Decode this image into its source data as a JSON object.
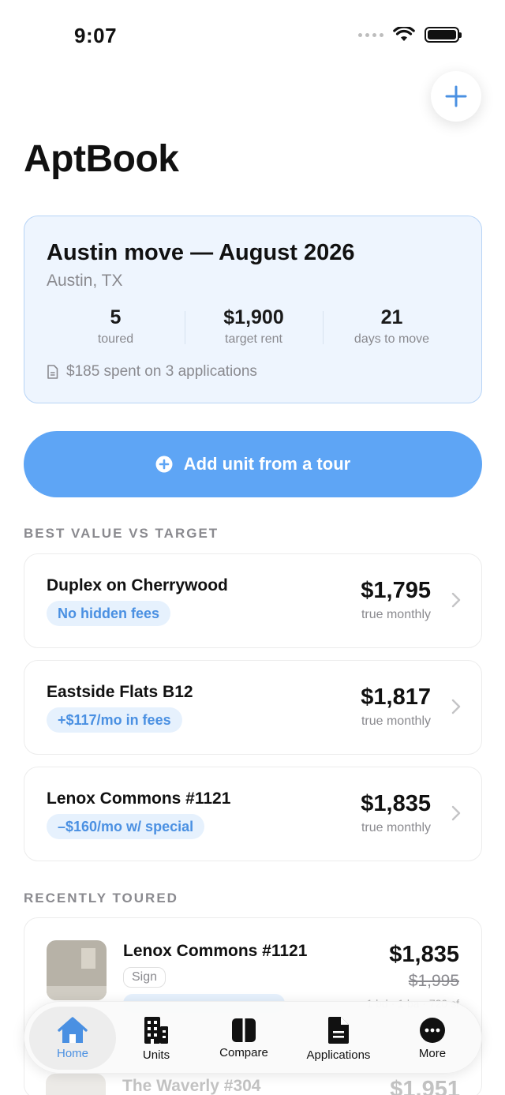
{
  "status": {
    "time": "9:07"
  },
  "header": {
    "title": "AptBook",
    "add_icon": "plus-icon"
  },
  "move": {
    "title": "Austin move — August 2026",
    "location": "Austin, TX",
    "stats": [
      {
        "value": "5",
        "label": "toured"
      },
      {
        "value": "$1,900",
        "label": "target rent"
      },
      {
        "value": "21",
        "label": "days to move"
      }
    ],
    "spent": "$185 spent on 3 applications"
  },
  "actions": {
    "add_unit": "Add unit from a tour"
  },
  "best_value": {
    "heading": "BEST VALUE VS TARGET",
    "items": [
      {
        "name": "Duplex on Cherrywood",
        "tag": "No hidden fees",
        "price": "$1,795",
        "sub": "true monthly"
      },
      {
        "name": "Eastside Flats B12",
        "tag": "+$117/mo in fees",
        "price": "$1,817",
        "sub": "true monthly"
      },
      {
        "name": "Lenox Commons #1121",
        "tag": "–$160/mo w/ special",
        "price": "$1,835",
        "sub": "true monthly"
      }
    ]
  },
  "recent": {
    "heading": "RECENTLY TOURED",
    "items": [
      {
        "name": "Lenox Commons #1121",
        "chip": "Sign",
        "price": "$1,835",
        "old_price": "$1,995",
        "meta": "1 bd · 1 ba · 720 sf"
      },
      {
        "name": "The Waverly #304",
        "price": "$1,951"
      }
    ]
  },
  "tabs": [
    {
      "label": "Home",
      "icon": "house-icon",
      "active": true
    },
    {
      "label": "Units",
      "icon": "building-icon"
    },
    {
      "label": "Compare",
      "icon": "compare-icon"
    },
    {
      "label": "Applications",
      "icon": "document-icon"
    },
    {
      "label": "More",
      "icon": "more-icon"
    }
  ],
  "colors": {
    "accent": "#5ea5f5",
    "accent_text": "#4a90e2",
    "card_tint": "#eef5fe",
    "tag_bg": "#e6f1fd"
  }
}
